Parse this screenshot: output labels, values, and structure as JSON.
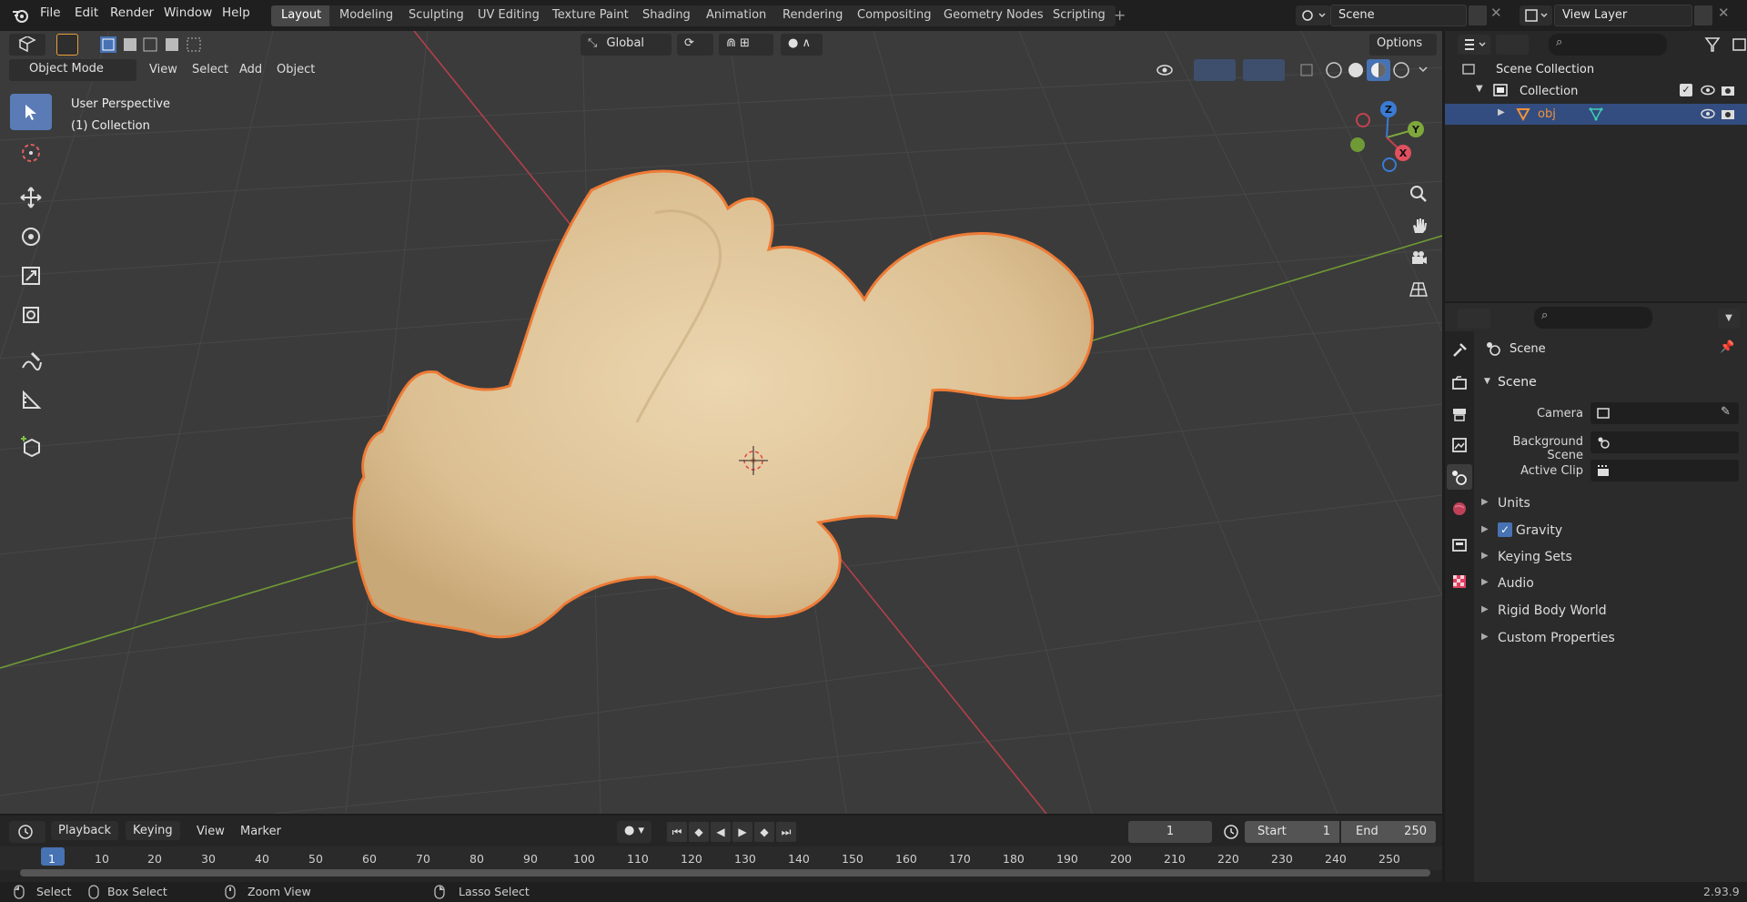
{
  "menu": [
    "File",
    "Edit",
    "Render",
    "Window",
    "Help"
  ],
  "workspaces": [
    "Layout",
    "Modeling",
    "Sculpting",
    "UV Editing",
    "Texture Paint",
    "Shading",
    "Animation",
    "Rendering",
    "Compositing",
    "Geometry Nodes",
    "Scripting"
  ],
  "active_workspace": "Layout",
  "scene_field": "Scene",
  "view_layer_field": "View Layer",
  "viewport": {
    "mode": "Object Mode",
    "menus": [
      "View",
      "Select",
      "Add",
      "Object"
    ],
    "orientation": "Global",
    "options_label": "Options",
    "overlay_title": "User Perspective",
    "overlay_subtitle": "(1) Collection",
    "gizmo_axes": {
      "x": "X",
      "y": "Y",
      "z": "Z"
    }
  },
  "outliner": {
    "scene_collection": "Scene Collection",
    "collection": "Collection",
    "object": "obj"
  },
  "properties": {
    "header": "Scene",
    "panel_scene": "Scene",
    "camera_label": "Camera",
    "background_scene_label": "Background Scene",
    "active_clip_label": "Active Clip",
    "panels": [
      "Units",
      "Gravity",
      "Keying Sets",
      "Audio",
      "Rigid Body World",
      "Custom Properties"
    ],
    "gravity_checked": true
  },
  "timeline": {
    "menus": [
      "Playback",
      "Keying",
      "View",
      "Marker"
    ],
    "current_frame": "1",
    "start_label": "Start",
    "start_value": "1",
    "end_label": "End",
    "end_value": "250",
    "ruler": [
      "1",
      "10",
      "20",
      "30",
      "40",
      "50",
      "60",
      "70",
      "80",
      "90",
      "100",
      "110",
      "120",
      "130",
      "140",
      "150",
      "160",
      "170",
      "180",
      "190",
      "200",
      "210",
      "220",
      "230",
      "240",
      "250"
    ]
  },
  "statusbar": {
    "select": "Select",
    "box_select": "Box Select",
    "zoom_view": "Zoom View",
    "lasso_select": "Lasso Select",
    "version": "2.93.9"
  },
  "colors": {
    "accent": "#4772b3",
    "selection_outline": "#e8773a",
    "x_axis": "#c2424e",
    "y_axis": "#7ea83c",
    "z_axis": "#3a7bd5",
    "mesh": "#e3c9a0"
  }
}
